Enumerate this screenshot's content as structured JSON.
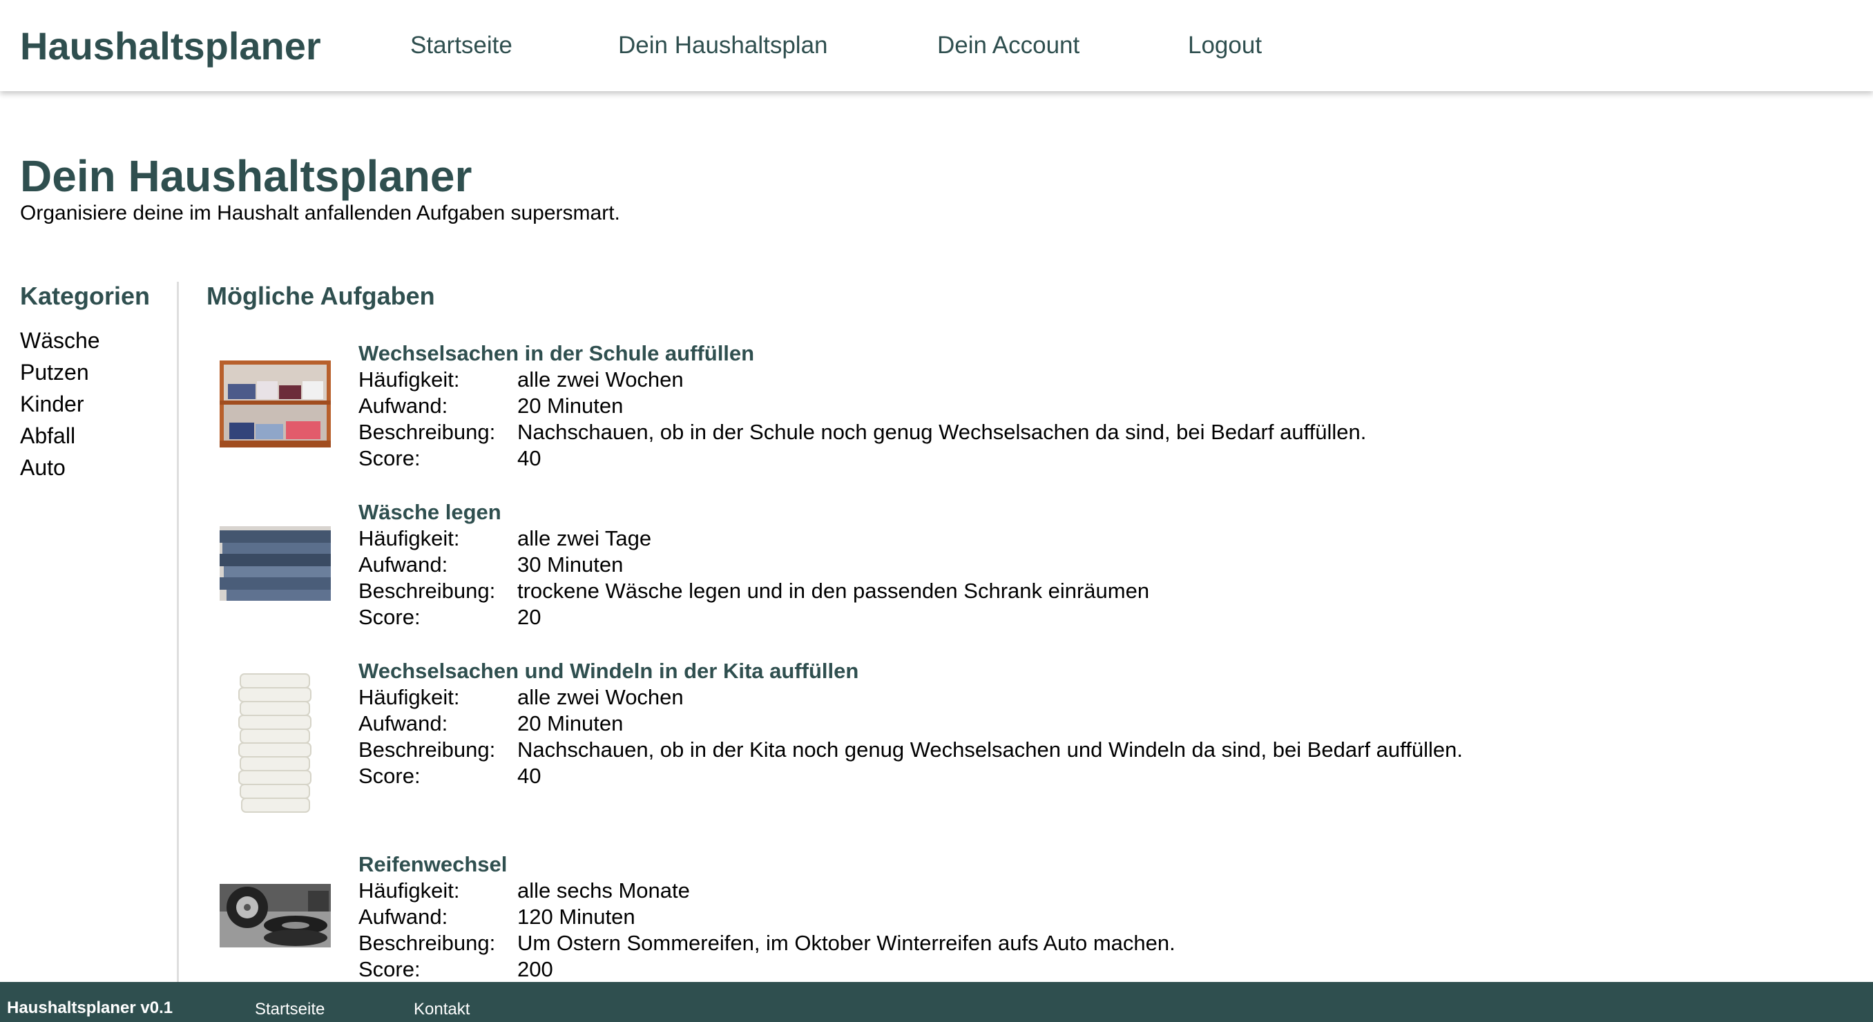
{
  "header": {
    "brand": "Haushaltsplaner",
    "nav": [
      "Startseite",
      "Dein Haushaltsplan",
      "Dein Account",
      "Logout"
    ]
  },
  "page": {
    "title": "Dein Haushaltsplaner",
    "subtitle": "Organisiere deine im Haushalt anfallenden Aufgaben supersmart."
  },
  "sidebar": {
    "title": "Kategorien",
    "items": [
      "Wäsche",
      "Putzen",
      "Kinder",
      "Abfall",
      "Auto"
    ]
  },
  "main": {
    "title": "Mögliche Aufgaben",
    "labels": {
      "frequency": "Häufigkeit:",
      "effort": "Aufwand:",
      "description": "Beschreibung:",
      "score": "Score:"
    },
    "tasks": [
      {
        "title": "Wechselsachen in der Schule auffüllen",
        "frequency": "alle zwei Wochen",
        "effort": "20 Minuten",
        "description": "Nachschauen, ob in der Schule noch genug Wechselsachen da sind, bei Bedarf auffüllen.",
        "score": "40",
        "image": "shelf-clothes-image"
      },
      {
        "title": "Wäsche legen",
        "frequency": "alle zwei Tage",
        "effort": "30 Minuten",
        "description": "trockene Wäsche legen und in den passenden Schrank einräumen",
        "score": "20",
        "image": "jeans-stack-image"
      },
      {
        "title": "Wechselsachen und Windeln in der Kita auffüllen",
        "frequency": "alle zwei Wochen",
        "effort": "20 Minuten",
        "description": "Nachschauen, ob in der Kita noch genug Wechselsachen und Windeln da sind, bei Bedarf auffüllen.",
        "score": "40",
        "image": "diaper-stack-image"
      },
      {
        "title": "Reifenwechsel",
        "frequency": "alle sechs Monate",
        "effort": "120 Minuten",
        "description": "Um Ostern Sommereifen, im Oktober Winterreifen aufs Auto machen.",
        "score": "200",
        "image": "tires-image"
      }
    ]
  },
  "footer": {
    "brand": "Haushaltsplaner v0.1",
    "links": [
      "Startseite",
      "Kontakt"
    ]
  },
  "colors": {
    "primary": "#2f4f4f",
    "background": "#ffffff",
    "divider": "#dedede"
  }
}
